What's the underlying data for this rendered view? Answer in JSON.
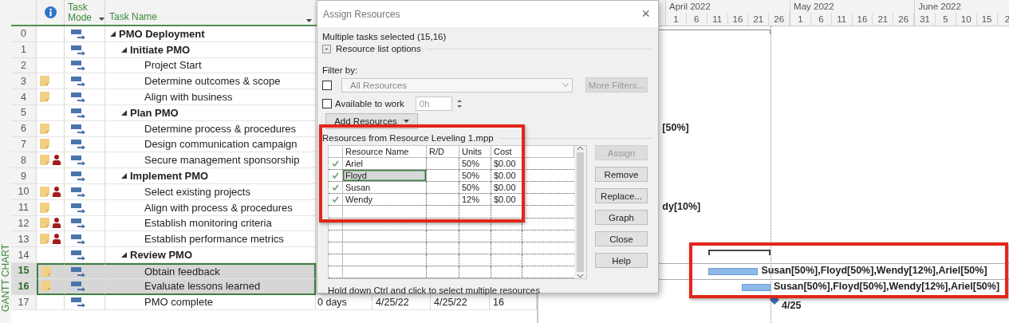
{
  "view_label": "GANTT CHART",
  "table": {
    "task_mode_header": "Task Mode",
    "task_name_header": "Task Name"
  },
  "tasks": [
    {
      "id": "0",
      "name": "PMO Deployment",
      "note": false,
      "overallocated": false,
      "selected": false,
      "expanded": true,
      "bar": {
        "kind": "project"
      },
      "children": [
        {
          "id": "1",
          "name": "Initiate PMO",
          "note": false,
          "overallocated": false,
          "selected": false,
          "expanded": true,
          "children": [
            {
              "id": "2",
              "name": "Project Start",
              "note": false,
              "overallocated": false,
              "selected": false
            },
            {
              "id": "3",
              "name": "Determine outcomes & scope",
              "note": true,
              "overallocated": false,
              "selected": false
            },
            {
              "id": "4",
              "name": "Align with business",
              "note": true,
              "overallocated": false,
              "selected": false
            }
          ]
        },
        {
          "id": "5",
          "name": "Plan PMO",
          "note": false,
          "overallocated": false,
          "selected": false,
          "expanded": true,
          "children": [
            {
              "id": "6",
              "name": "Determine process & procedures",
              "note": true,
              "overallocated": false,
              "selected": false,
              "bar": {
                "kind": "label",
                "label": "[50%]"
              }
            },
            {
              "id": "7",
              "name": "Design communication campaign",
              "note": true,
              "overallocated": false,
              "selected": false
            },
            {
              "id": "8",
              "name": "Secure management sponsorship",
              "note": true,
              "overallocated": true,
              "selected": false
            }
          ]
        },
        {
          "id": "9",
          "name": "Implement PMO",
          "note": false,
          "overallocated": false,
          "selected": false,
          "expanded": true,
          "children": [
            {
              "id": "10",
              "name": "Select existing projects",
              "note": true,
              "overallocated": true,
              "selected": false
            },
            {
              "id": "11",
              "name": "Align with process & procedures",
              "note": true,
              "overallocated": false,
              "selected": false,
              "bar": {
                "kind": "label",
                "label": "dy[10%]"
              }
            },
            {
              "id": "12",
              "name": "Establish monitoring criteria",
              "note": true,
              "overallocated": true,
              "selected": false
            },
            {
              "id": "13",
              "name": "Establish performance metrics",
              "note": true,
              "overallocated": true,
              "selected": false
            }
          ]
        },
        {
          "id": "14",
          "name": "Review PMO",
          "note": false,
          "overallocated": false,
          "selected": false,
          "expanded": true,
          "bar": {
            "kind": "summary"
          },
          "children": [
            {
              "id": "15",
              "name": "Obtain feedback",
              "note": true,
              "overallocated": false,
              "selected": true,
              "bar": {
                "kind": "task",
                "label": "Susan[50%],Floyd[50%],Wendy[12%],Ariel[50%]"
              }
            },
            {
              "id": "16",
              "name": "Evaluate lessons learned",
              "note": true,
              "overallocated": false,
              "selected": true,
              "bar": {
                "kind": "task",
                "label": "Susan[50%],Floyd[50%],Wendy[12%],Ariel[50%]"
              }
            },
            {
              "id": "17",
              "name": "PMO complete",
              "note": false,
              "overallocated": false,
              "selected": false,
              "duration": "0 days",
              "start": "4/25/22",
              "finish": "4/25/22",
              "predecessors": "16",
              "bar": {
                "kind": "milestone",
                "label": "4/25"
              }
            }
          ]
        }
      ]
    }
  ],
  "gantt": {
    "months": [
      {
        "label": "April 2022",
        "days": [
          "1",
          "6",
          "11",
          "16",
          "21",
          "26"
        ]
      },
      {
        "label": "May 2022",
        "days": [
          "1",
          "6",
          "11",
          "16",
          "21",
          "26"
        ]
      },
      {
        "label": "June 2022",
        "days": [
          "31",
          "5",
          "10",
          "15",
          "2"
        ]
      }
    ]
  },
  "dialog": {
    "title": "Assign Resources",
    "close": "×",
    "selection": "Multiple tasks selected (15,16)",
    "options_toggle": "-",
    "options_label": "Resource list options",
    "filter_label": "Filter by:",
    "filter_checked": false,
    "filter_value": "All Resources",
    "more_filters": "More Filters...",
    "available_label": "Available to work",
    "available_checked": false,
    "available_value": "0h",
    "add_resources": "Add Resources",
    "list_title": "Resources from Resource Leveling 1.mpp",
    "columns": [
      "Resource Name",
      "R/D",
      "Units",
      "Cost"
    ],
    "resources": [
      {
        "name": "Ariel",
        "units": "50%",
        "cost": "$0.00",
        "assigned": true,
        "selected": false
      },
      {
        "name": "Floyd",
        "units": "50%",
        "cost": "$0.00",
        "assigned": true,
        "selected": true
      },
      {
        "name": "Susan",
        "units": "50%",
        "cost": "$0.00",
        "assigned": true,
        "selected": false
      },
      {
        "name": "Wendy",
        "units": "12%",
        "cost": "$0.00",
        "assigned": true,
        "selected": false
      }
    ],
    "buttons": [
      {
        "label": "Assign",
        "disabled": true
      },
      {
        "label": "Remove",
        "disabled": false
      },
      {
        "label": "Replace...",
        "disabled": false
      },
      {
        "label": "Graph",
        "disabled": false
      },
      {
        "label": "Close",
        "disabled": false
      },
      {
        "label": "Help",
        "disabled": false
      }
    ],
    "hint": "Hold down Ctrl and click to select multiple resources"
  }
}
